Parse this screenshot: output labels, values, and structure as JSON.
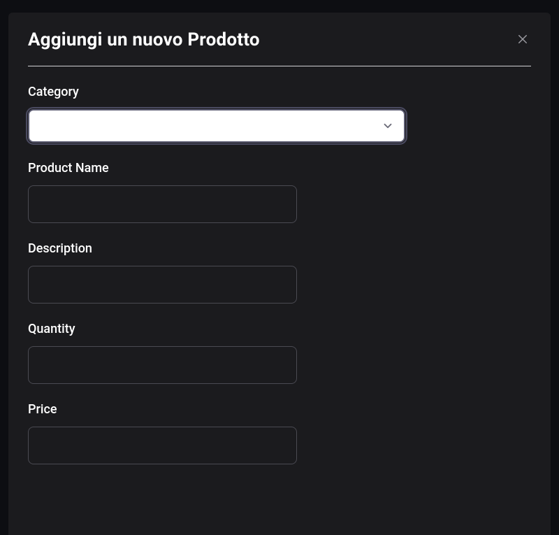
{
  "modal": {
    "title": "Aggiungi un nuovo Prodotto",
    "fields": {
      "category": {
        "label": "Category",
        "selected": ""
      },
      "productName": {
        "label": "Product Name",
        "value": ""
      },
      "description": {
        "label": "Description",
        "value": ""
      },
      "quantity": {
        "label": "Quantity",
        "value": ""
      },
      "price": {
        "label": "Price",
        "value": ""
      }
    }
  }
}
